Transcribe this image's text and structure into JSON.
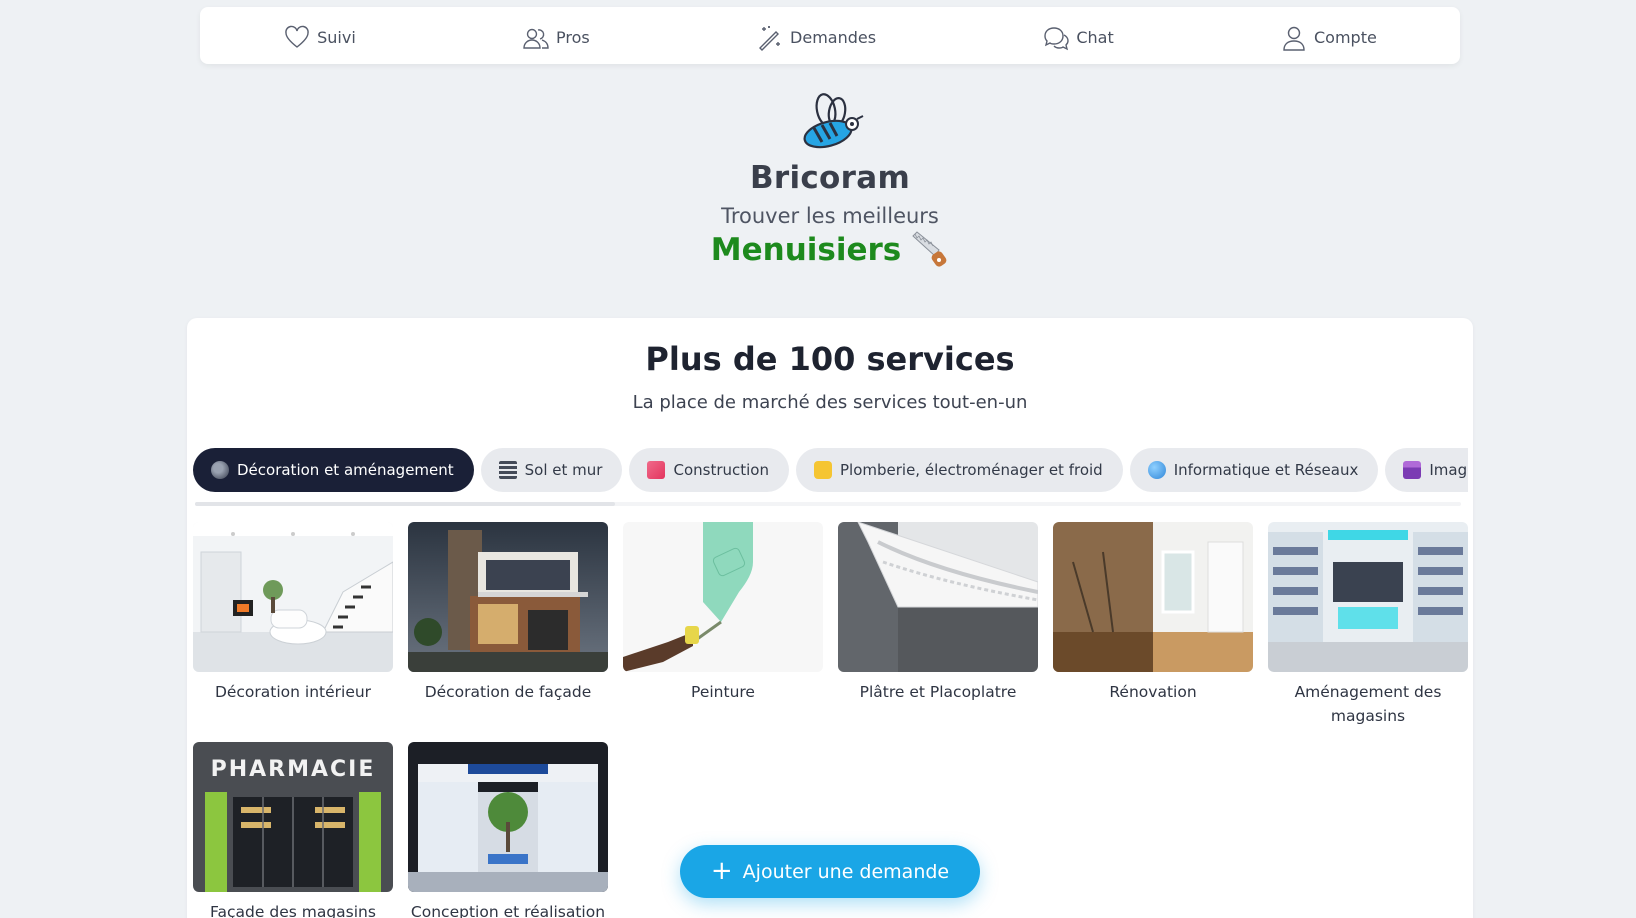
{
  "nav": {
    "items": [
      {
        "label": "Suivi",
        "icon": "heart-icon"
      },
      {
        "label": "Pros",
        "icon": "users-icon"
      },
      {
        "label": "Demandes",
        "icon": "magic-wand-icon"
      },
      {
        "label": "Chat",
        "icon": "chat-bubbles-icon"
      },
      {
        "label": "Compte",
        "icon": "user-icon"
      }
    ]
  },
  "hero": {
    "brand": "Bricoram",
    "tagline": "Trouver les meilleurs",
    "profession": "Menuisiers",
    "profession_color": "#1d8a1d"
  },
  "services": {
    "title": "Plus de 100 services",
    "subtitle": "La place de marché des services tout-en-un",
    "categories": [
      {
        "label": "Décoration et aménagement",
        "icon": "palette-icon",
        "active": true
      },
      {
        "label": "Sol et mur",
        "icon": "brick-wall-icon"
      },
      {
        "label": "Construction",
        "icon": "building-icon"
      },
      {
        "label": "Plomberie, électroménager et froid",
        "icon": "plumbing-icon"
      },
      {
        "label": "Informatique et Réseaux",
        "icon": "globe-icon"
      },
      {
        "label": "Image, impr",
        "icon": "printer-icon"
      }
    ],
    "items": [
      {
        "label": "Décoration intérieur",
        "image": "interior-living-room"
      },
      {
        "label": "Décoration de façade",
        "image": "modern-house-facade"
      },
      {
        "label": "Peinture",
        "image": "paint-roller-wall"
      },
      {
        "label": "Plâtre et Placoplatre",
        "image": "plaster-cornice"
      },
      {
        "label": "Rénovation",
        "image": "room-before-after"
      },
      {
        "label": "Aménagement des magasins",
        "image": "pharmacy-shop-interior"
      },
      {
        "label": "Façade des magasins",
        "image": "pharmacie-storefront"
      },
      {
        "label": "Conception et réalisation des stands",
        "image": "exhibition-stand"
      }
    ],
    "pharmacy_sign": "PHARMACIE"
  },
  "fab": {
    "label": "Ajouter une demande",
    "color": "#1aa6e6"
  },
  "colors": {
    "background": "#eef1f4",
    "active_chip": "#1a2037",
    "accent": "#1aa6e6"
  }
}
